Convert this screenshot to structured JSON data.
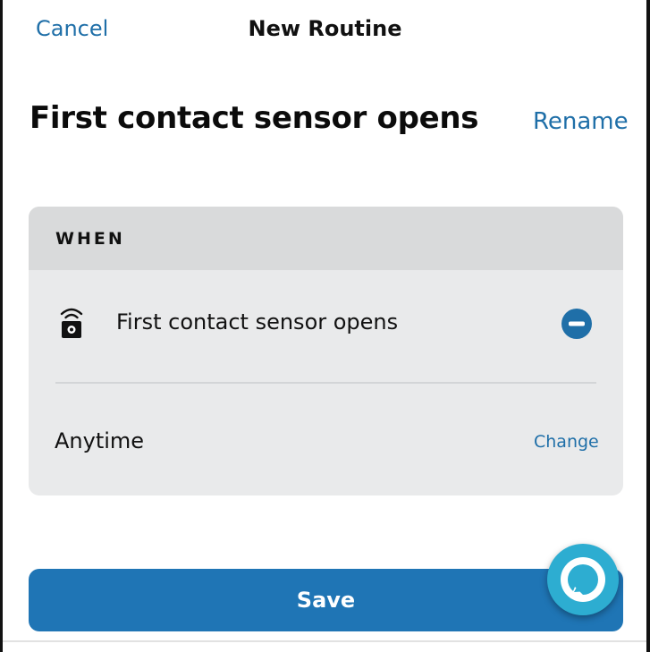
{
  "header": {
    "cancel_label": "Cancel",
    "title": "New Routine"
  },
  "routine": {
    "name": "First contact sensor opens",
    "rename_label": "Rename"
  },
  "when_card": {
    "section_label": "WHEN",
    "trigger": {
      "icon": "contact-sensor-icon",
      "label": "First contact sensor opens",
      "remove_icon": "remove-circle-icon"
    },
    "schedule": {
      "label": "Anytime",
      "change_label": "Change"
    }
  },
  "footer": {
    "save_label": "Save"
  },
  "assistant": {
    "icon": "alexa-ring-icon"
  },
  "colors": {
    "accent": "#1f6fa8",
    "save_button": "#1f75b5",
    "card_bg": "#e9eaeb",
    "card_header_bg": "#d9dadb",
    "alexa": "#2dadd1"
  }
}
